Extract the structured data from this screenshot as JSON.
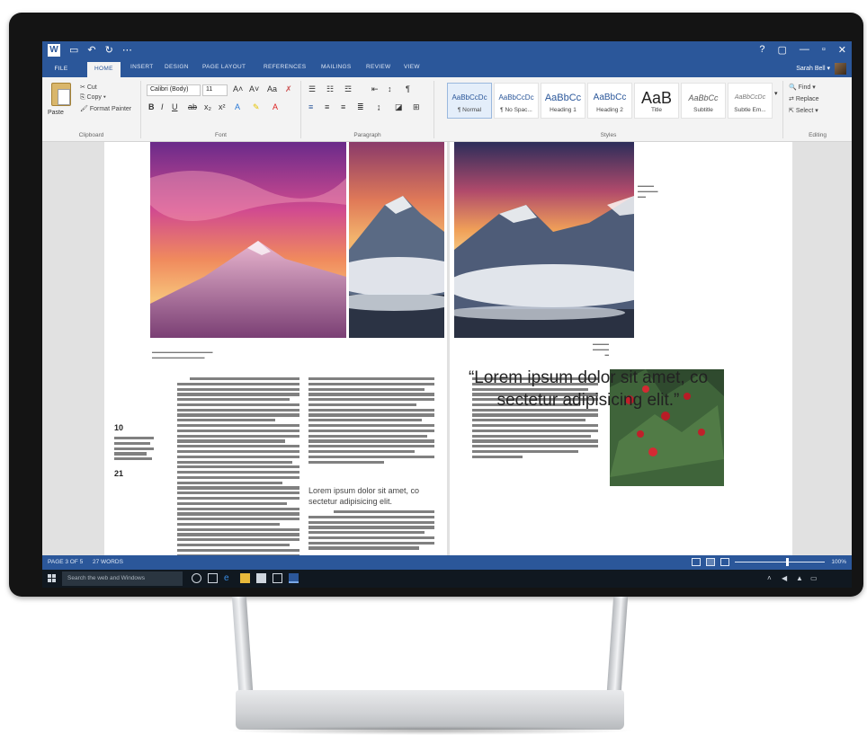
{
  "window": {
    "app_letter": "W",
    "doc_title": ""
  },
  "window_controls": [
    "?",
    "▢",
    "—",
    "▫",
    "✕"
  ],
  "tabs": [
    "FILE",
    "HOME",
    "INSERT",
    "DESIGN",
    "PAGE LAYOUT",
    "REFERENCES",
    "MAILINGS",
    "REVIEW",
    "VIEW"
  ],
  "user": "Sarah Bell ▾",
  "clipboard": {
    "paste": "Paste",
    "cut": "Cut",
    "copy": "Copy ▾",
    "format_painter": "Format Painter",
    "label": "Clipboard"
  },
  "font": {
    "name": "Calibri (Body)",
    "size": "11",
    "label": "Font"
  },
  "paragraph": {
    "label": "Paragraph"
  },
  "styles": {
    "label": "Styles",
    "items": [
      {
        "preview": "AaBbCcDc",
        "name": "¶ Normal"
      },
      {
        "preview": "AaBbCcDc",
        "name": "¶ No Spac..."
      },
      {
        "preview": "AaBbCc",
        "name": "Heading 1"
      },
      {
        "preview": "AaBbCc",
        "name": "Heading 2"
      },
      {
        "preview": "AaB",
        "name": "Title"
      },
      {
        "preview": "AaBbCc",
        "name": "Subtitle"
      },
      {
        "preview": "AaBbCcDc",
        "name": "Subtle Em..."
      }
    ]
  },
  "editing": {
    "find": "Find ▾",
    "replace": "Replace",
    "select": "Select ▾",
    "label": "Editing"
  },
  "document": {
    "sidebar_num_top": "10",
    "sidebar_num_bottom": "21",
    "subhead": "Lorem ipsum dolor sit amet, co sectetur adipisicing elit.",
    "quote": "“Lorem ipsum dolor sit amet, co sectetur adipisicing elit.”"
  },
  "status": {
    "page": "PAGE 3 OF 5",
    "words": "27 WORDS",
    "zoom": "100%",
    "zoom_level": 0.58
  },
  "taskbar": {
    "search_placeholder": "Search the web and Windows",
    "time": "",
    "date": ""
  }
}
